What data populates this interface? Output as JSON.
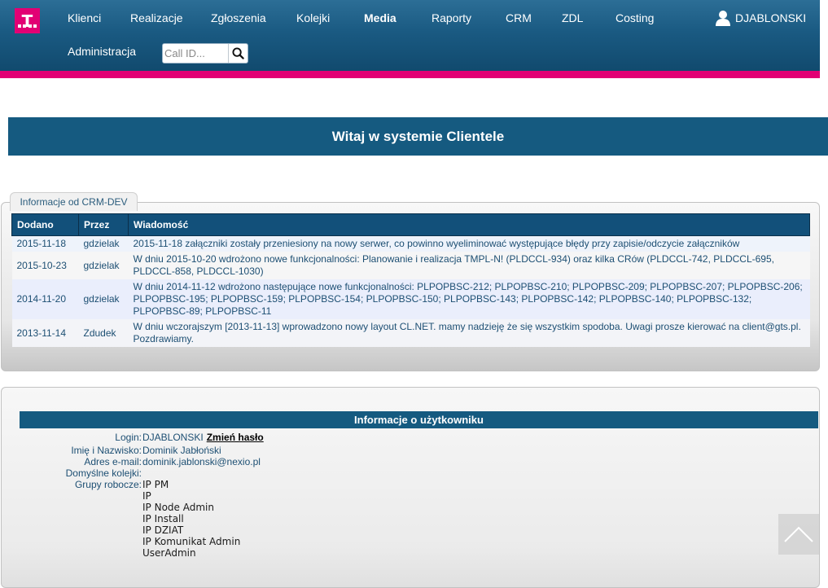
{
  "brand": {
    "logo_letter": "T",
    "color": "#e20074"
  },
  "nav": {
    "items": [
      {
        "label": "Klienci"
      },
      {
        "label": "Realizacje"
      },
      {
        "label": "Zgłoszenia"
      },
      {
        "label": "Kolejki"
      },
      {
        "label": "Media",
        "active": true
      },
      {
        "label": "Raporty"
      },
      {
        "label": "CRM"
      },
      {
        "label": "ZDL"
      },
      {
        "label": "Costing"
      },
      {
        "label": "Administracja"
      }
    ],
    "user": "DJABLONSKI"
  },
  "search": {
    "placeholder": "Call ID...",
    "icon": "search-icon"
  },
  "welcome": {
    "title": "Witaj w systemie Clientele"
  },
  "crm": {
    "tab_label": "Informacje od CRM-DEV",
    "columns": [
      "Dodano",
      "Przez",
      "Wiadomość"
    ],
    "rows": [
      {
        "date": "2015-11-18",
        "by": "gdzielak",
        "message": "2015-11-18 załączniki zostały przeniesiony na nowy serwer, co powinno wyeliminować występujące błędy przy zapisie/odczycie załączników"
      },
      {
        "date": "2015-10-23",
        "by": "gdzielak",
        "message": "W dniu 2015-10-20 wdrożono nowe funkcjonalności: Planowanie i realizacja TMPL-N! (PLDCCL-934) oraz kilka CRów (PLDCCL-742, PLDCCL-695, PLDCCL-858, PLDCCL-1030)"
      },
      {
        "date": "2014-11-20",
        "by": "gdzielak",
        "message": "W dniu 2014-11-12 wdrożono następujące nowe funkcjonalności: PLPOPBSC-212; PLPOPBSC-210; PLPOPBSC-209; PLPOPBSC-207; PLPOPBSC-206; PLPOPBSC-195; PLPOPBSC-159; PLPOPBSC-154; PLPOPBSC-150; PLPOPBSC-143; PLPOPBSC-142; PLPOPBSC-140; PLPOPBSC-132; PLPOPBSC-89; PLPOPBSC-11"
      },
      {
        "date": "2013-11-14",
        "by": "Zdudek",
        "message": "W dniu wczorajszym [2013-11-13] wprowadzono nowy layout CL.NET. mamy nadzieję że się wszystkim spodoba. Uwagi prosze kierować na client@gts.pl. Pozdrawiamy."
      }
    ]
  },
  "user_info": {
    "title": "Informacje o użytkowniku",
    "login_label": "Login:",
    "login": "DJABLONSKI",
    "change_password": "Zmień hasło",
    "name_label": "Imię i Nazwisko:",
    "name": "Dominik Jabłoński",
    "email_label": "Adres e-mail:",
    "email": "dominik.jablonski@nexio.pl",
    "queues_label": "Domyślne kolejki:",
    "queues": "",
    "groups_label": "Grupy robocze:",
    "groups": [
      "IP PM",
      "IP",
      "IP Node Admin",
      "IP Install",
      "IP DZIAT",
      "IP Komunikat Admin",
      "UserAdmin"
    ]
  }
}
